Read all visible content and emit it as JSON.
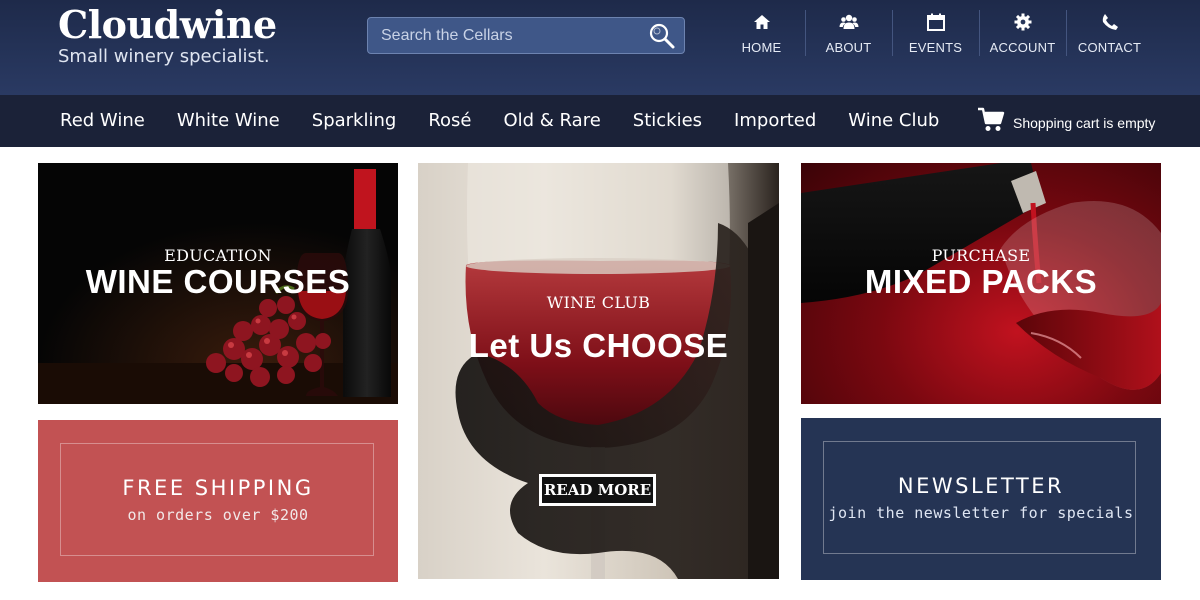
{
  "brand": {
    "name": "Cloudwine",
    "tagline": "Small winery specialist."
  },
  "search": {
    "placeholder": "Search the Cellars",
    "icon": "search-icon"
  },
  "top_nav": [
    {
      "label": "HOME",
      "icon": "home-icon"
    },
    {
      "label": "ABOUT",
      "icon": "users-icon"
    },
    {
      "label": "EVENTS",
      "icon": "calendar-icon"
    },
    {
      "label": "ACCOUNT",
      "icon": "gear-icon"
    },
    {
      "label": "CONTACT",
      "icon": "phone-icon"
    }
  ],
  "categories": [
    "Red Wine",
    "White Wine",
    "Sparkling",
    "Rosé",
    "Old & Rare",
    "Stickies",
    "Imported",
    "Wine Club"
  ],
  "cart": {
    "label": "Shopping cart is empty",
    "icon": "cart-icon"
  },
  "tiles": {
    "education": {
      "kicker": "EDUCATION",
      "title": "WINE COURSES"
    },
    "club": {
      "kicker": "WINE CLUB",
      "title": "Let Us CHOOSE",
      "button": "READ MORE"
    },
    "mixed": {
      "kicker": "PURCHASE",
      "title": "MIXED PACKS"
    },
    "shipping": {
      "title": "FREE SHIPPING",
      "subtitle": "on orders over $200"
    },
    "newsletter": {
      "title": "NEWSLETTER",
      "subtitle": "join the newsletter for specials"
    }
  },
  "colors": {
    "header": "#253454",
    "category_bar": "#1b2238",
    "shipping_tile": "#c25253",
    "newsletter_tile": "#253454"
  }
}
